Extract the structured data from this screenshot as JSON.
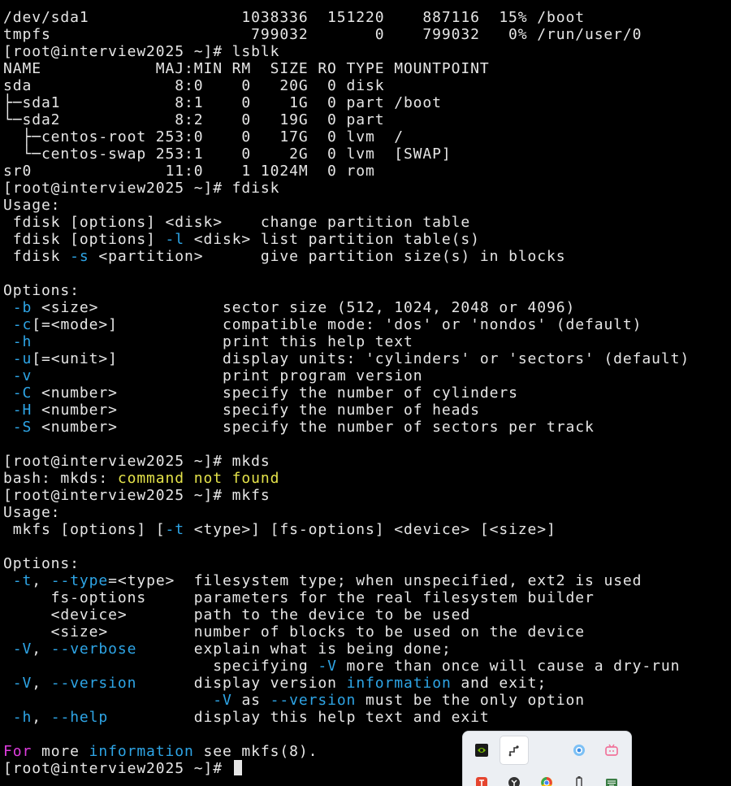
{
  "terminal": {
    "prompt": "[root@interview2025 ~]# ",
    "lines": [
      [
        {
          "t": "/dev/sda1                1038336  151220    887116  15% /boot"
        }
      ],
      [
        {
          "t": "tmpfs                     799032       0    799032   0% /run/user/0"
        }
      ],
      [
        {
          "t": "[root@interview2025 ~]# lsblk"
        }
      ],
      [
        {
          "t": "NAME            MAJ:MIN RM  SIZE RO TYPE MOUNTPOINT"
        }
      ],
      [
        {
          "t": "sda               8:0    0   20G  0 disk"
        }
      ],
      [
        {
          "t": "├─sda1            8:1    0    1G  0 part /boot"
        }
      ],
      [
        {
          "t": "└─sda2            8:2    0   19G  0 part"
        }
      ],
      [
        {
          "t": "  ├─centos-root 253:0    0   17G  0 lvm  /"
        }
      ],
      [
        {
          "t": "  └─centos-swap 253:1    0    2G  0 lvm  [SWAP]"
        }
      ],
      [
        {
          "t": "sr0              11:0    1 1024M  0 rom"
        }
      ],
      [
        {
          "t": "[root@interview2025 ~]# fdisk"
        }
      ],
      [
        {
          "t": "Usage:"
        }
      ],
      [
        {
          "t": " fdisk [options] <disk>    change partition table"
        }
      ],
      [
        {
          "t": " fdisk [options] "
        },
        {
          "t": "-l",
          "c": "opt"
        },
        {
          "t": " <disk> list partition table(s)"
        }
      ],
      [
        {
          "t": " fdisk "
        },
        {
          "t": "-s",
          "c": "opt"
        },
        {
          "t": " <partition>      give partition size(s) in blocks"
        }
      ],
      [
        {
          "t": ""
        }
      ],
      [
        {
          "t": "Options:"
        }
      ],
      [
        {
          "t": " "
        },
        {
          "t": "-b",
          "c": "opt"
        },
        {
          "t": " <size>             sector size (512, 1024, 2048 or 4096)"
        }
      ],
      [
        {
          "t": " "
        },
        {
          "t": "-c",
          "c": "opt"
        },
        {
          "t": "[=<mode>]           compatible mode: 'dos' or 'nondos' (default)"
        }
      ],
      [
        {
          "t": " "
        },
        {
          "t": "-h",
          "c": "opt"
        },
        {
          "t": "                    print this help text"
        }
      ],
      [
        {
          "t": " "
        },
        {
          "t": "-u",
          "c": "opt"
        },
        {
          "t": "[=<unit>]           display units: 'cylinders' or 'sectors' (default)"
        }
      ],
      [
        {
          "t": " "
        },
        {
          "t": "-v",
          "c": "opt"
        },
        {
          "t": "                    print program version"
        }
      ],
      [
        {
          "t": " "
        },
        {
          "t": "-C",
          "c": "opt"
        },
        {
          "t": " <number>           specify the number of cylinders"
        }
      ],
      [
        {
          "t": " "
        },
        {
          "t": "-H",
          "c": "opt"
        },
        {
          "t": " <number>           specify the number of heads"
        }
      ],
      [
        {
          "t": " "
        },
        {
          "t": "-S",
          "c": "opt"
        },
        {
          "t": " <number>           specify the number of sectors per track"
        }
      ],
      [
        {
          "t": ""
        }
      ],
      [
        {
          "t": "[root@interview2025 ~]# mkds"
        }
      ],
      [
        {
          "t": "bash: mkds: "
        },
        {
          "t": "command not found",
          "c": "err"
        }
      ],
      [
        {
          "t": "[root@interview2025 ~]# mkfs"
        }
      ],
      [
        {
          "t": "Usage:"
        }
      ],
      [
        {
          "t": " mkfs [options] ["
        },
        {
          "t": "-t",
          "c": "opt"
        },
        {
          "t": " <type>] [fs-options] <device> [<size>]"
        }
      ],
      [
        {
          "t": ""
        }
      ],
      [
        {
          "t": "Options:"
        }
      ],
      [
        {
          "t": " "
        },
        {
          "t": "-t",
          "c": "opt"
        },
        {
          "t": ", "
        },
        {
          "t": "--type",
          "c": "opt"
        },
        {
          "t": "=<type>  filesystem type; when unspecified, ext2 is used"
        }
      ],
      [
        {
          "t": "     fs-options     parameters for the real filesystem builder"
        }
      ],
      [
        {
          "t": "     <device>       path to the device to be used"
        }
      ],
      [
        {
          "t": "     <size>         number of blocks to be used on the device"
        }
      ],
      [
        {
          "t": " "
        },
        {
          "t": "-V",
          "c": "opt"
        },
        {
          "t": ", "
        },
        {
          "t": "--verbose",
          "c": "opt"
        },
        {
          "t": "      explain what is being done;"
        }
      ],
      [
        {
          "t": "                      specifying "
        },
        {
          "t": "-V",
          "c": "opt"
        },
        {
          "t": " more than once will cause a dry-run"
        }
      ],
      [
        {
          "t": " "
        },
        {
          "t": "-V",
          "c": "opt"
        },
        {
          "t": ", "
        },
        {
          "t": "--version",
          "c": "opt"
        },
        {
          "t": "      display version "
        },
        {
          "t": "information",
          "c": "info"
        },
        {
          "t": " and exit;"
        }
      ],
      [
        {
          "t": "                      "
        },
        {
          "t": "-V",
          "c": "opt"
        },
        {
          "t": " as "
        },
        {
          "t": "--version",
          "c": "opt"
        },
        {
          "t": " must be the only option"
        }
      ],
      [
        {
          "t": " "
        },
        {
          "t": "-h",
          "c": "opt"
        },
        {
          "t": ", "
        },
        {
          "t": "--help",
          "c": "opt"
        },
        {
          "t": "         display this help text and exit"
        }
      ],
      [
        {
          "t": ""
        }
      ],
      [
        {
          "t": "For",
          "c": "for"
        },
        {
          "t": " more "
        },
        {
          "t": "information",
          "c": "info"
        },
        {
          "t": " see mkfs(8)."
        }
      ]
    ]
  },
  "colors": {
    "background": "#000000",
    "foreground": "#e6e6e6",
    "option": "#2ea5e6",
    "error": "#e5e34a",
    "keyword": "#e03de0"
  },
  "tray": {
    "icons": [
      {
        "name": "nvidia-icon",
        "color": "#76b900",
        "active": false
      },
      {
        "name": "pen-tablet-icon",
        "color": "#333333",
        "active": true
      },
      {
        "name": "cloud-sync-icon",
        "color": "#3d8fe6",
        "active": false
      },
      {
        "name": "bilibili-icon",
        "color": "#f0739a",
        "active": false
      },
      {
        "name": "red-app-icon",
        "color": "#e5452f",
        "active": false
      },
      {
        "name": "shield-app-icon",
        "color": "#333333",
        "active": false
      },
      {
        "name": "chrome-icon",
        "color": "#34a853",
        "active": false
      },
      {
        "name": "usb-device-icon",
        "color": "#444444",
        "active": false
      },
      {
        "name": "keyboard-icon",
        "color": "#3a7d44",
        "active": false
      }
    ]
  }
}
